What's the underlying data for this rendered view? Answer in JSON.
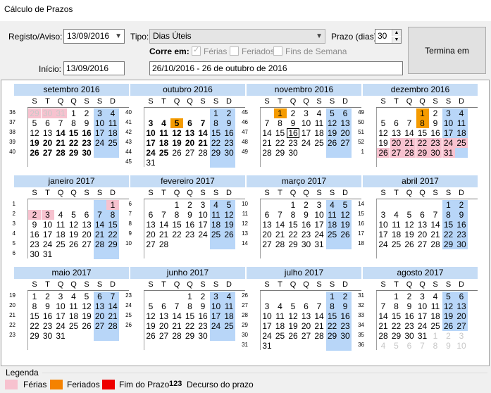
{
  "window": {
    "title": "Cálculo de Prazos"
  },
  "form": {
    "registo_label": "Registo/Aviso:",
    "registo_value": "13/09/2016",
    "tipo_label": "Tipo:",
    "tipo_value": "Dias Úteis",
    "prazo_label": "Prazo (dias):",
    "prazo_value": "30",
    "corre_label": "Corre em:",
    "ferias_label": "Férias",
    "feriados_label": "Feriados",
    "fins_label": "Fins de Semana",
    "inicio_label": "Início:",
    "inicio_value": "13/09/2016",
    "resultado": "26/10/2016 - 26 de outubro de 2016",
    "termina_button": "Termina em"
  },
  "weekday_headers": [
    "S",
    "T",
    "Q",
    "Q",
    "S",
    "S",
    "D"
  ],
  "months": [
    {
      "title": "setembro  2016",
      "weeks": [
        "36",
        "37",
        "38",
        "39",
        "40"
      ],
      "rows": [
        [
          "29",
          "30",
          "31",
          "1",
          "2",
          "3",
          "4"
        ],
        [
          "5",
          "6",
          "7",
          "8",
          "9",
          "10",
          "11"
        ],
        [
          "12",
          "13",
          "14",
          "15",
          "16",
          "17",
          "18"
        ],
        [
          "19",
          "20",
          "21",
          "22",
          "23",
          "24",
          "25"
        ],
        [
          "26",
          "27",
          "28",
          "29",
          "30",
          "",
          ""
        ]
      ],
      "lead_dim": 3
    },
    {
      "title": "outubro  2016",
      "weeks": [
        "40",
        "41",
        "42",
        "43",
        "44",
        "45"
      ],
      "rows": [
        [
          "",
          "",
          "",
          "",
          "",
          "1",
          "2"
        ],
        [
          "3",
          "4",
          "5",
          "6",
          "7",
          "8",
          "9"
        ],
        [
          "10",
          "11",
          "12",
          "13",
          "14",
          "15",
          "16"
        ],
        [
          "17",
          "18",
          "19",
          "20",
          "21",
          "22",
          "23"
        ],
        [
          "24",
          "25",
          "26",
          "27",
          "28",
          "29",
          "30"
        ],
        [
          "31",
          "",
          "",
          "",
          "",
          "",
          ""
        ]
      ]
    },
    {
      "title": "novembro  2016",
      "weeks": [
        "45",
        "46",
        "47",
        "48",
        "49"
      ],
      "rows": [
        [
          "",
          "1",
          "2",
          "3",
          "4",
          "5",
          "6"
        ],
        [
          "7",
          "8",
          "9",
          "10",
          "11",
          "12",
          "13"
        ],
        [
          "14",
          "15",
          "16",
          "17",
          "18",
          "19",
          "20"
        ],
        [
          "21",
          "22",
          "23",
          "24",
          "25",
          "26",
          "27"
        ],
        [
          "28",
          "29",
          "30",
          "",
          "",
          "",
          ""
        ]
      ]
    },
    {
      "title": "dezembro  2016",
      "weeks": [
        "49",
        "50",
        "51",
        "52",
        "1"
      ],
      "rows": [
        [
          "",
          "",
          "",
          "1",
          "2",
          "3",
          "4"
        ],
        [
          "5",
          "6",
          "7",
          "8",
          "9",
          "10",
          "11"
        ],
        [
          "12",
          "13",
          "14",
          "15",
          "16",
          "17",
          "18"
        ],
        [
          "19",
          "20",
          "21",
          "22",
          "23",
          "24",
          "25"
        ],
        [
          "26",
          "27",
          "28",
          "29",
          "30",
          "31",
          ""
        ]
      ]
    },
    {
      "title": "janeiro  2017",
      "weeks": [
        "1",
        "2",
        "3",
        "4",
        "5",
        "6"
      ],
      "rows": [
        [
          "",
          "",
          "",
          "",
          "",
          "",
          "1"
        ],
        [
          "2",
          "3",
          "4",
          "5",
          "6",
          "7",
          "8"
        ],
        [
          "9",
          "10",
          "11",
          "12",
          "13",
          "14",
          "15"
        ],
        [
          "16",
          "17",
          "18",
          "19",
          "20",
          "21",
          "22"
        ],
        [
          "23",
          "24",
          "25",
          "26",
          "27",
          "28",
          "29"
        ],
        [
          "30",
          "31",
          "",
          "",
          "",
          "",
          ""
        ]
      ]
    },
    {
      "title": "fevereiro  2017",
      "weeks": [
        "6",
        "7",
        "8",
        "9",
        "10"
      ],
      "rows": [
        [
          "",
          "",
          "1",
          "2",
          "3",
          "4",
          "5"
        ],
        [
          "6",
          "7",
          "8",
          "9",
          "10",
          "11",
          "12"
        ],
        [
          "13",
          "14",
          "15",
          "16",
          "17",
          "18",
          "19"
        ],
        [
          "20",
          "21",
          "22",
          "23",
          "24",
          "25",
          "26"
        ],
        [
          "27",
          "28",
          "",
          "",
          "",
          "",
          ""
        ]
      ]
    },
    {
      "title": "março  2017",
      "weeks": [
        "10",
        "11",
        "12",
        "13",
        "14"
      ],
      "rows": [
        [
          "",
          "",
          "1",
          "2",
          "3",
          "4",
          "5"
        ],
        [
          "6",
          "7",
          "8",
          "9",
          "10",
          "11",
          "12"
        ],
        [
          "13",
          "14",
          "15",
          "16",
          "17",
          "18",
          "19"
        ],
        [
          "20",
          "21",
          "22",
          "23",
          "24",
          "25",
          "26"
        ],
        [
          "27",
          "28",
          "29",
          "30",
          "31",
          "",
          ""
        ]
      ]
    },
    {
      "title": "abril  2017",
      "weeks": [
        "14",
        "15",
        "16",
        "17",
        "18"
      ],
      "rows": [
        [
          "",
          "",
          "",
          "",
          "",
          "1",
          "2"
        ],
        [
          "3",
          "4",
          "5",
          "6",
          "7",
          "8",
          "9"
        ],
        [
          "10",
          "11",
          "12",
          "13",
          "14",
          "15",
          "16"
        ],
        [
          "17",
          "18",
          "19",
          "20",
          "21",
          "22",
          "23"
        ],
        [
          "24",
          "25",
          "26",
          "27",
          "28",
          "29",
          "30"
        ]
      ]
    },
    {
      "title": "maio  2017",
      "weeks": [
        "19",
        "20",
        "21",
        "22",
        "23"
      ],
      "rows": [
        [
          "1",
          "2",
          "3",
          "4",
          "5",
          "6",
          "7"
        ],
        [
          "8",
          "9",
          "10",
          "11",
          "12",
          "13",
          "14"
        ],
        [
          "15",
          "16",
          "17",
          "18",
          "19",
          "20",
          "21"
        ],
        [
          "22",
          "23",
          "24",
          "25",
          "26",
          "27",
          "28"
        ],
        [
          "29",
          "30",
          "31",
          "",
          "",
          "",
          ""
        ]
      ]
    },
    {
      "title": "junho  2017",
      "weeks": [
        "23",
        "24",
        "25",
        "26"
      ],
      "rows": [
        [
          "",
          "",
          "",
          "1",
          "2",
          "3",
          "4"
        ],
        [
          "5",
          "6",
          "7",
          "8",
          "9",
          "10",
          "11"
        ],
        [
          "12",
          "13",
          "14",
          "15",
          "16",
          "17",
          "18"
        ],
        [
          "19",
          "20",
          "21",
          "22",
          "23",
          "24",
          "25"
        ],
        [
          "26",
          "27",
          "28",
          "29",
          "30",
          "",
          ""
        ]
      ]
    },
    {
      "title": "julho  2017",
      "weeks": [
        "26",
        "27",
        "28",
        "29",
        "30",
        "31"
      ],
      "rows": [
        [
          "",
          "",
          "",
          "",
          "",
          "1",
          "2"
        ],
        [
          "3",
          "4",
          "5",
          "6",
          "7",
          "8",
          "9"
        ],
        [
          "10",
          "11",
          "12",
          "13",
          "14",
          "15",
          "16"
        ],
        [
          "17",
          "18",
          "19",
          "20",
          "21",
          "22",
          "23"
        ],
        [
          "24",
          "25",
          "26",
          "27",
          "28",
          "29",
          "30"
        ],
        [
          "31",
          "",
          "",
          "",
          "",
          "",
          ""
        ]
      ]
    },
    {
      "title": "agosto  2017",
      "weeks": [
        "31",
        "32",
        "33",
        "34",
        "35",
        "36"
      ],
      "rows": [
        [
          "",
          "1",
          "2",
          "3",
          "4",
          "5",
          "6"
        ],
        [
          "7",
          "8",
          "9",
          "10",
          "11",
          "12",
          "13"
        ],
        [
          "14",
          "15",
          "16",
          "17",
          "18",
          "19",
          "20"
        ],
        [
          "21",
          "22",
          "23",
          "24",
          "25",
          "26",
          "27"
        ],
        [
          "28",
          "29",
          "30",
          "31",
          "1",
          "2",
          "3"
        ],
        [
          "4",
          "5",
          "6",
          "7",
          "8",
          "9",
          "10"
        ]
      ]
    }
  ],
  "legend": {
    "title": "Legenda",
    "ferias": "Férias",
    "feriados": "Feriados",
    "fim": "Fim do Prazo",
    "decurso_num": "123",
    "decurso": "Decurso do prazo",
    "colors": {
      "ferias": "#f7c2cf",
      "feriados": "#f58200",
      "fim": "#ee0000"
    }
  }
}
